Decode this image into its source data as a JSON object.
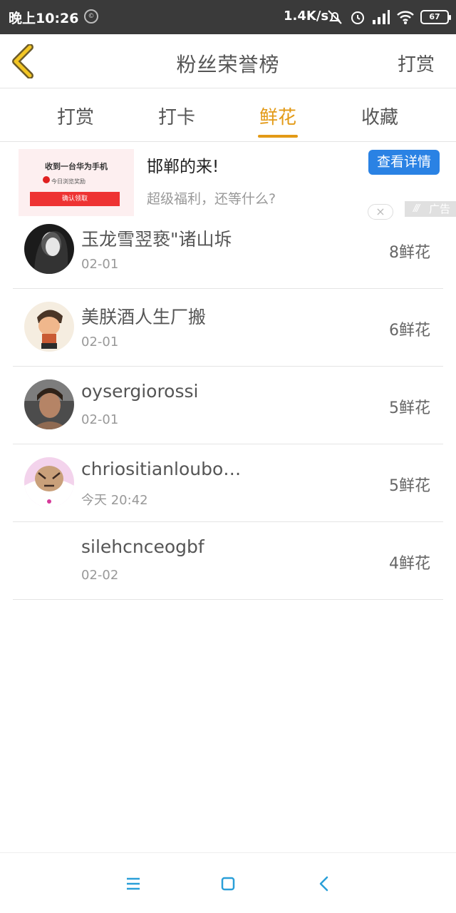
{
  "status_bar": {
    "time": "晚上10:26",
    "app_icon": "©",
    "net_speed": "1.4K/s",
    "battery": "67"
  },
  "header": {
    "title": "粉丝荣誉榜",
    "action": "打赏",
    "back_icon": "chevron-left-icon"
  },
  "tabs": [
    {
      "label": "打赏",
      "active": false
    },
    {
      "label": "打卡",
      "active": false
    },
    {
      "label": "鲜花",
      "active": true
    },
    {
      "label": "收藏",
      "active": false
    }
  ],
  "ad": {
    "thumb_title": "收到一台华为手机",
    "thumb_sub": "今日浏览奖励",
    "thumb_button": "确认领取",
    "title": "邯郸的来!",
    "subtitle": "超级福利，还等什么?",
    "button": "查看详情",
    "close": "×",
    "badge": "广告"
  },
  "fans": [
    {
      "name": "玉龙雪翌亵\"诸山坼",
      "date": "02-01",
      "score": "8鲜花"
    },
    {
      "name": "美朕酒人生厂搬",
      "date": "02-01",
      "score": "6鲜花"
    },
    {
      "name": "oysergiorossi",
      "date": "02-01",
      "score": "5鲜花"
    },
    {
      "name": "chriositianloubo…",
      "date": "今天 20:42",
      "score": "5鲜花"
    },
    {
      "name": "silehcnceogbf",
      "date": "02-02",
      "score": "4鲜花"
    }
  ],
  "colors": {
    "accent": "#e39a16",
    "ad_button": "#2a82e4",
    "nav_icon": "#2a9fd8"
  }
}
